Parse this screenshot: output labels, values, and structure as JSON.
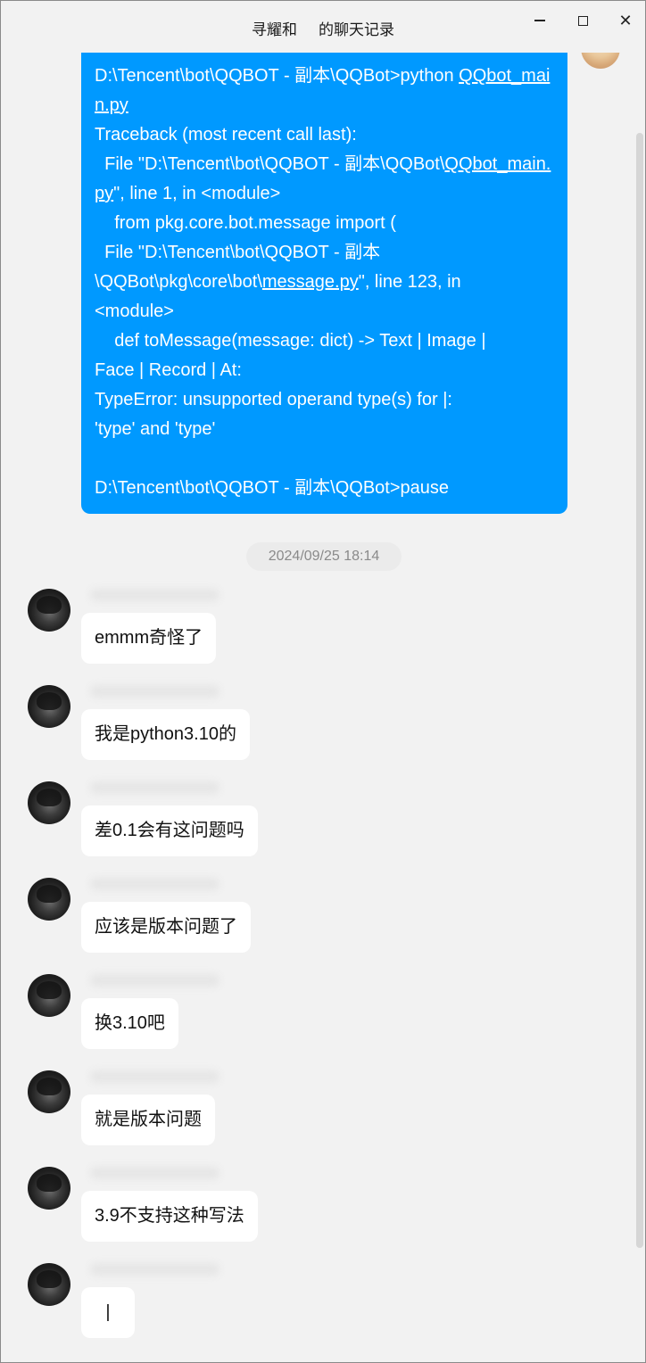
{
  "window": {
    "title_part1": "寻耀和",
    "title_part2": "的聊天记录",
    "close_glyph": "✕"
  },
  "self_message": {
    "line1_pre": "D:\\Tencent\\bot\\QQBOT - 副本\\QQBot>python ",
    "line1_link": "QQbot_main.py",
    "line2": "Traceback (most recent call last):",
    "line3_pre": "  File \"D:\\Tencent\\bot\\QQBOT - 副本\\QQBot\\",
    "line3_link": "QQbot_main.py",
    "line3_post": "\", line 1, in <module>",
    "line4": "    from pkg.core.bot.message import (",
    "line5_pre": "  File \"D:\\Tencent\\bot\\QQBOT - 副本\n\\QQBot\\pkg\\core\\bot\\",
    "line5_link": "message.py",
    "line5_post": "\", line 123, in\n<module>",
    "line6": "    def toMessage(message: dict) -> Text | Image |\nFace | Record | At:",
    "line7": "TypeError: unsupported operand type(s) for |:\n'type' and 'type'",
    "line8": "D:\\Tencent\\bot\\QQBOT - 副本\\QQBot>pause"
  },
  "timestamp": "2024/09/25 18:14",
  "messages": [
    {
      "text": "emmm奇怪了"
    },
    {
      "text": "我是python3.10的"
    },
    {
      "text": "差0.1会有这问题吗"
    },
    {
      "text": "应该是版本问题了"
    },
    {
      "text": "换3.10吧"
    },
    {
      "text": "就是版本问题"
    },
    {
      "text": "3.9不支持这种写法"
    },
    {
      "text": "|"
    }
  ],
  "colors": {
    "self_bubble": "#0099ff",
    "background": "#f2f2f2",
    "other_bubble": "#ffffff"
  },
  "icons": {
    "minimize": "minimize-icon",
    "maximize": "maximize-icon",
    "close": "close-icon"
  }
}
